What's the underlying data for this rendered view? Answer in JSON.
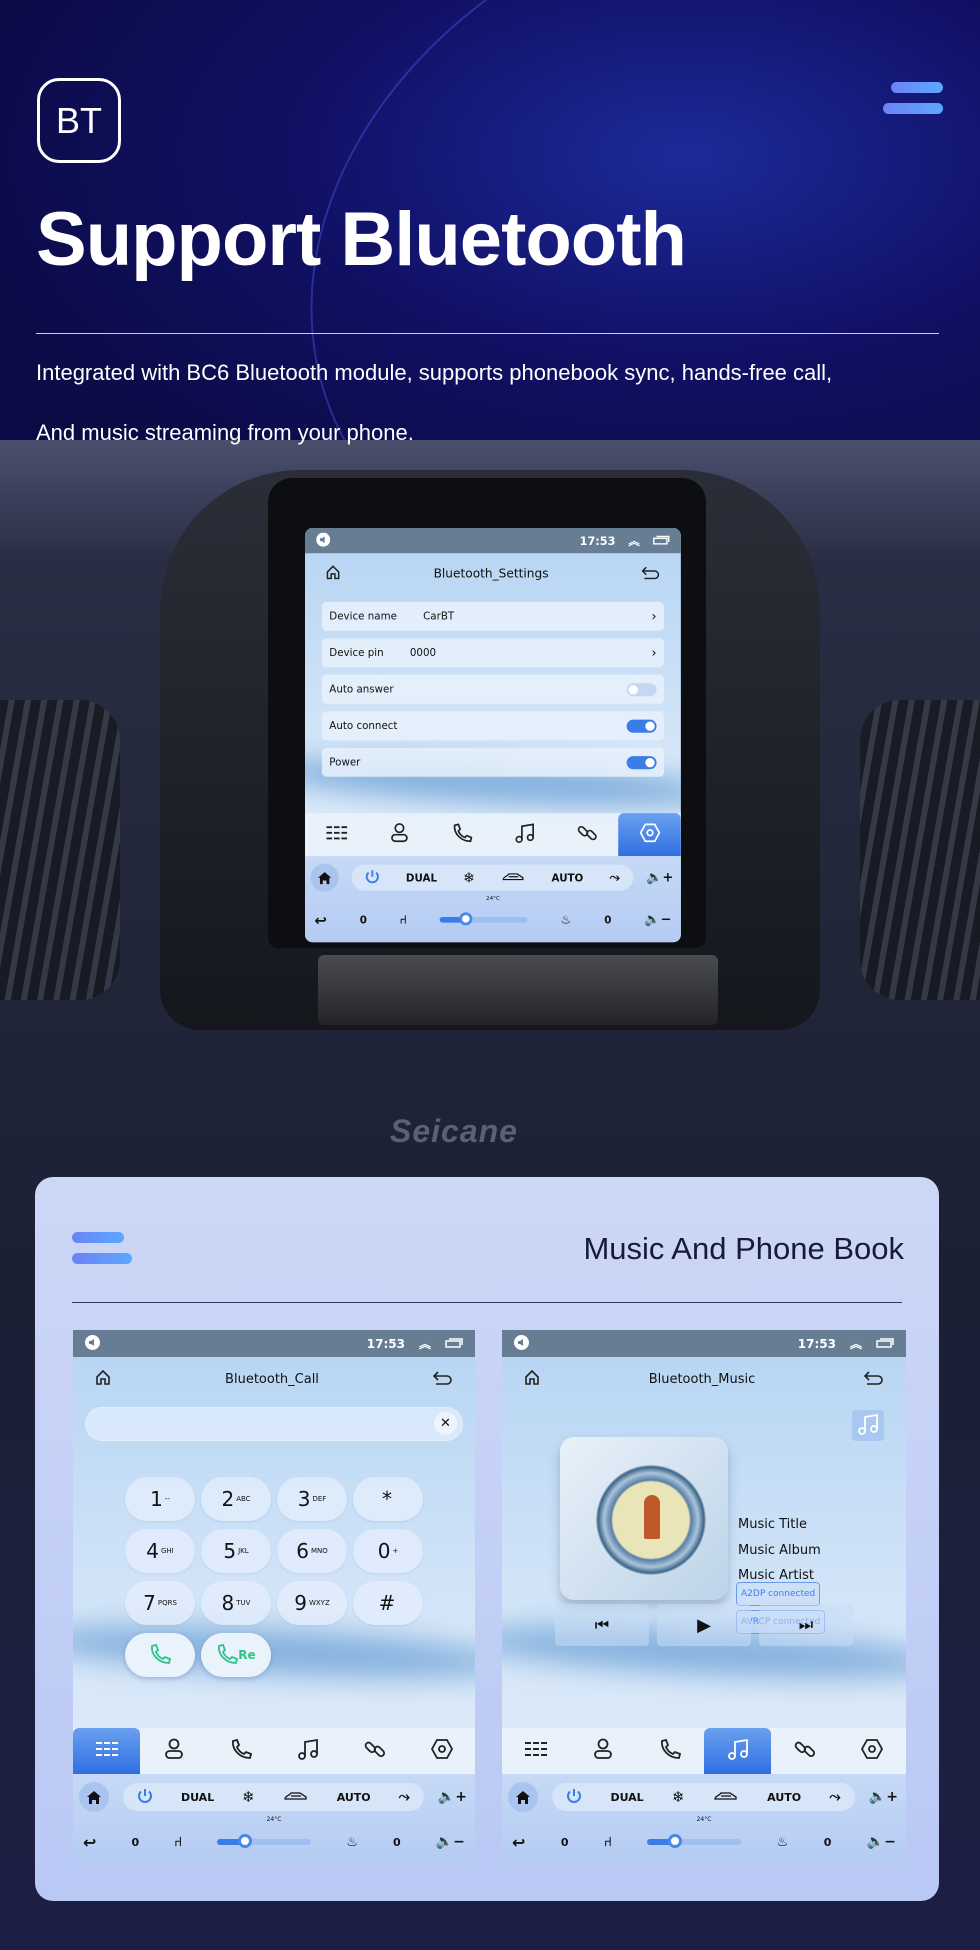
{
  "hero": {
    "badge": "BT",
    "title": "Support Bluetooth",
    "lines": [
      "Integrated with BC6 Bluetooth module, supports phonebook sync, hands-free call,",
      "And music streaming from your phone."
    ],
    "brand_watermark": "Seicane",
    "accent": "#5aa8ff"
  },
  "card": {
    "title": "Music And Phone Book"
  },
  "climate": {
    "dual": "DUAL",
    "auto": "AUTO",
    "temp": "24°C",
    "left_level": "0",
    "right_level": "0",
    "fan_level": 0.3
  },
  "nav_icons": [
    "menu-icon",
    "contacts-icon",
    "phone-icon",
    "music-icon",
    "link-icon",
    "settings-icon"
  ],
  "settings_screen": {
    "time": "17:53",
    "title": "Bluetooth_Settings",
    "active_nav": 5,
    "rows": [
      {
        "label": "Device name",
        "value": "CarBT",
        "type": "link"
      },
      {
        "label": "Device pin",
        "value": "0000",
        "type": "link"
      },
      {
        "label": "Auto answer",
        "type": "toggle",
        "on": false
      },
      {
        "label": "Auto connect",
        "type": "toggle",
        "on": true
      },
      {
        "label": "Power",
        "type": "toggle",
        "on": true
      }
    ],
    "toggle_on_color": "#3b7de8"
  },
  "call_screen": {
    "time": "17:53",
    "title": "Bluetooth_Call",
    "active_nav": 0,
    "number_value": "",
    "keys": [
      {
        "main": "1",
        "sub": "--"
      },
      {
        "main": "2",
        "sub": "ABC"
      },
      {
        "main": "3",
        "sub": "DEF"
      },
      {
        "main": "*",
        "sub": ""
      },
      {
        "main": "4",
        "sub": "GHI"
      },
      {
        "main": "5",
        "sub": "JKL"
      },
      {
        "main": "6",
        "sub": "MNO"
      },
      {
        "main": "0",
        "sub": "+"
      },
      {
        "main": "7",
        "sub": "PQRS"
      },
      {
        "main": "8",
        "sub": "TUV"
      },
      {
        "main": "9",
        "sub": "WXYZ"
      },
      {
        "main": "#",
        "sub": ""
      }
    ],
    "redial_label": "Re",
    "call_color": "#2fc28a"
  },
  "music_screen": {
    "time": "17:53",
    "title": "Bluetooth_Music",
    "active_nav": 3,
    "track_title": "Music Title",
    "album": "Music Album",
    "artist": "Music Artist",
    "badges": [
      "A2DP  connected",
      "AVRCP connected"
    ]
  }
}
